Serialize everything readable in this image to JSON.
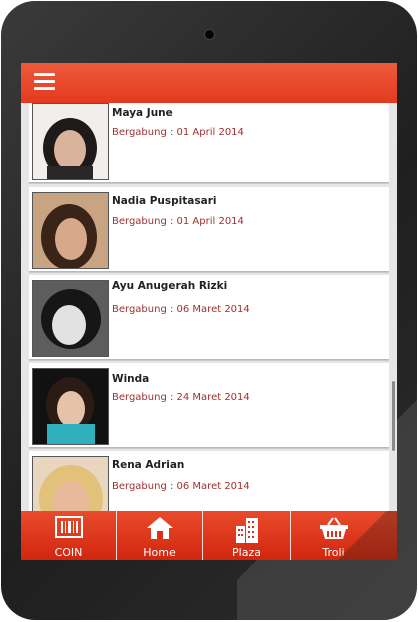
{
  "users": [
    {
      "name": "Maya June",
      "joined": "Bergabung : 01 April 2014",
      "avatar_color": "#5a4a48"
    },
    {
      "name": "Nadia Puspitasari",
      "joined": "Bergabung : 01 April 2014",
      "avatar_color": "#b08a6a"
    },
    {
      "name": "Ayu Anugerah Rizki",
      "joined": "Bergabung : 06 Maret 2014",
      "avatar_color": "#6e6e6e"
    },
    {
      "name": "Winda",
      "joined": "Bergabung : 24 Maret 2014",
      "avatar_color": "#2e9aa6"
    },
    {
      "name": "Rena Adrian",
      "joined": "Bergabung : 06 Maret 2014",
      "avatar_color": "#c8a46a"
    }
  ],
  "nav": [
    {
      "label": "COIN",
      "icon": "coin-icon"
    },
    {
      "label": "Home",
      "icon": "home-icon"
    },
    {
      "label": "Plaza",
      "icon": "building-icon"
    },
    {
      "label": "Troli",
      "icon": "basket-icon"
    }
  ],
  "colors": {
    "accent": "#e33a1e",
    "joined_text": "#a03030"
  }
}
